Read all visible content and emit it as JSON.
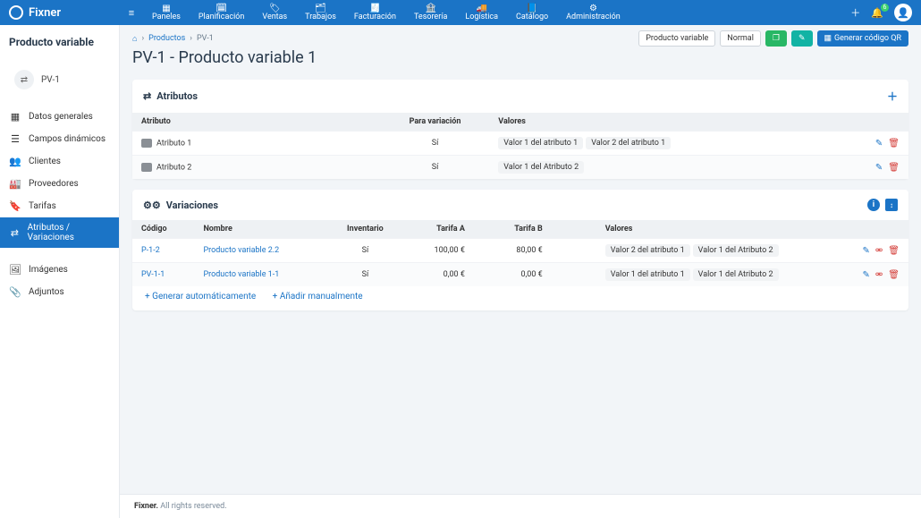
{
  "brand": "Fixner",
  "nav": [
    {
      "label": "Paneles",
      "icon": "▦"
    },
    {
      "label": "Planificación",
      "icon": "🗓"
    },
    {
      "label": "Ventas",
      "icon": "🏷"
    },
    {
      "label": "Trabajos",
      "icon": "🗂"
    },
    {
      "label": "Facturación",
      "icon": "🧾"
    },
    {
      "label": "Tesorería",
      "icon": "🏦"
    },
    {
      "label": "Logística",
      "icon": "🚚"
    },
    {
      "label": "Catálogo",
      "icon": "📘"
    },
    {
      "label": "Administración",
      "icon": "⚙"
    }
  ],
  "notifications_badge": "6",
  "sidebar": {
    "title": "Producto variable",
    "chip": "PV-1",
    "items": [
      {
        "icon": "▦",
        "label": "Datos generales"
      },
      {
        "icon": "☰",
        "label": "Campos dinámicos"
      },
      {
        "icon": "👥",
        "label": "Clientes"
      },
      {
        "icon": "🏭",
        "label": "Proveedores"
      },
      {
        "icon": "🔖",
        "label": "Tarifas"
      },
      {
        "icon": "⇄",
        "label": "Atributos / Variaciones"
      }
    ],
    "items2": [
      {
        "icon": "🖼",
        "label": "Imágenes"
      },
      {
        "icon": "📎",
        "label": "Adjuntos"
      }
    ]
  },
  "breadcrumb": {
    "home": "⌂",
    "link1": "Productos",
    "current": "PV-1"
  },
  "header_buttons": {
    "variable": "Producto variable",
    "normal": "Normal",
    "qr": "Generar código QR"
  },
  "page_title": "PV-1 - Producto variable 1",
  "attributes": {
    "title": "Atributos",
    "columns": {
      "attr": "Atributo",
      "variation": "Para variación",
      "values": "Valores"
    },
    "rows": [
      {
        "name": "Atributo 1",
        "for_variation": "Sí",
        "values": [
          "Valor 1 del atributo 1",
          "Valor 2 del atributo 1"
        ]
      },
      {
        "name": "Atributo 2",
        "for_variation": "Sí",
        "values": [
          "Valor 1 del Atributo 2"
        ]
      }
    ]
  },
  "variations": {
    "title": "Variaciones",
    "columns": {
      "code": "Código",
      "name": "Nombre",
      "inventory": "Inventario",
      "rateA": "Tarifa A",
      "rateB": "Tarifa B",
      "values": "Valores"
    },
    "rows": [
      {
        "code": "P-1-2",
        "name": "Producto variable 2.2",
        "inventory": "Sí",
        "rateA": "100,00 €",
        "rateB": "80,00 €",
        "values": [
          "Valor 2 del atributo 1",
          "Valor 1 del Atributo 2"
        ]
      },
      {
        "code": "PV-1-1",
        "name": "Producto variable 1-1",
        "inventory": "Sí",
        "rateA": "0,00 €",
        "rateB": "0,00 €",
        "values": [
          "Valor 1 del atributo 1",
          "Valor 1 del Atributo 2"
        ]
      }
    ],
    "gen_auto": "+ Generar automáticamente",
    "add_manual": "+ Añadir manualmente"
  },
  "footer": {
    "brand": "Fixner.",
    "text": " All rights reserved."
  }
}
